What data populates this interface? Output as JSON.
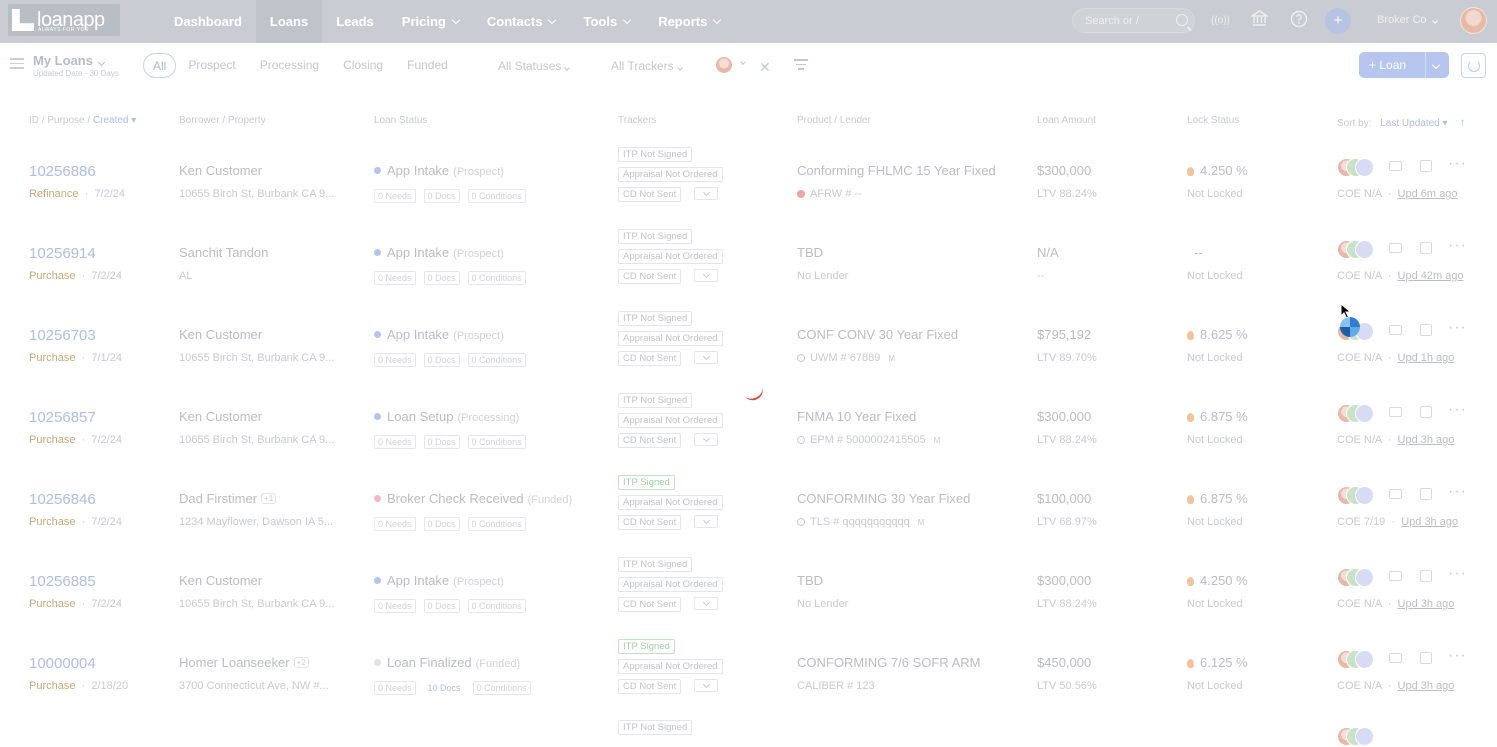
{
  "nav": {
    "logo_text": "loanapp",
    "logo_tag": "ALWAYS FOR YOU",
    "items": [
      {
        "label": "Dashboard",
        "active": false,
        "dropdown": false
      },
      {
        "label": "Loans",
        "active": true,
        "dropdown": false
      },
      {
        "label": "Leads",
        "active": false,
        "dropdown": false
      },
      {
        "label": "Pricing",
        "active": false,
        "dropdown": true
      },
      {
        "label": "Contacts",
        "active": false,
        "dropdown": true
      },
      {
        "label": "Tools",
        "active": false,
        "dropdown": true
      },
      {
        "label": "Reports",
        "active": false,
        "dropdown": true
      }
    ],
    "search_placeholder": "Search or /",
    "broadcast_icon": "((o))",
    "broker_label": "Broker Co"
  },
  "subbar": {
    "title": "My Loans",
    "subtitle": "Updated Date · 30 Days",
    "tabs": [
      "All",
      "Prospect",
      "Processing",
      "Closing",
      "Funded"
    ],
    "active_tab": "All",
    "status_filter": "All Statuses",
    "tracker_filter": "All Trackers",
    "new_loan_label": "+ Loan"
  },
  "columns": {
    "id_purpose": "ID / Purpose / ",
    "created": "Created",
    "borrower": "Borrower / Property",
    "status": "Loan Status",
    "trackers": "Trackers",
    "product": "Product / Lender",
    "amount": "Loan Amount",
    "lock": "Lock Status",
    "sort_by": "Sort by:",
    "sort_value": "Last Updated"
  },
  "loans": [
    {
      "id": "10256886",
      "purpose": "Refinance",
      "date": "7/2/24",
      "borrower": "Ken Customer",
      "co": "",
      "address": "10655 Birch St, Burbank CA 9...",
      "status": "App Intake",
      "stage": "(Prospect)",
      "dot": "blue",
      "needs": "0 Needs",
      "docs": "0 Docs",
      "conditions": "0 Conditions",
      "docs_blue": false,
      "t1": "ITP Not Signed",
      "t1_green": false,
      "t2": "Appraisal Not Ordered",
      "t3": "CD Not Sent",
      "product": "Conforming FHLMC 15 Year Fixed",
      "lender": "AFRW # --",
      "lender_icon": "red",
      "mtag": "",
      "amount": "$300,000",
      "ltv": "LTV 88.24%",
      "rate": "4.250 %",
      "rate_flame": true,
      "lock": "Not Locked",
      "coe": "COE N/A",
      "upd": "Upd 6m ago"
    },
    {
      "id": "10256914",
      "purpose": "Purchase",
      "date": "7/2/24",
      "borrower": "Sanchit Tandon",
      "co": "",
      "address": "AL",
      "status": "App Intake",
      "stage": "(Prospect)",
      "dot": "blue",
      "needs": "0 Needs",
      "docs": "0 Docs",
      "conditions": "0 Conditions",
      "docs_blue": false,
      "t1": "ITP Not Signed",
      "t1_green": false,
      "t2": "Appraisal Not Ordered",
      "t3": "CD Not Sent",
      "product": "TBD",
      "lender": "No Lender",
      "lender_icon": "",
      "mtag": "",
      "amount": "N/A",
      "ltv": "--",
      "rate": "--",
      "rate_flame": false,
      "lock": "Not Locked",
      "coe": "COE N/A",
      "upd": "Upd 42m ago"
    },
    {
      "id": "10256703",
      "purpose": "Purchase",
      "date": "7/1/24",
      "borrower": "Ken Customer",
      "co": "",
      "address": "10655 Birch St, Burbank CA 9...",
      "status": "App Intake",
      "stage": "(Prospect)",
      "dot": "blue",
      "needs": "0 Needs",
      "docs": "0 Docs",
      "conditions": "0 Conditions",
      "docs_blue": false,
      "t1": "ITP Not Signed",
      "t1_green": false,
      "t2": "Appraisal Not Ordered",
      "t3": "CD Not Sent",
      "product": "CONF CONV 30 Year Fixed",
      "lender": "UWM # 67889",
      "lender_icon": "gray",
      "mtag": "M",
      "amount": "$795,192",
      "ltv": "LTV 89.70%",
      "rate": "8.625 %",
      "rate_flame": true,
      "lock": "Not Locked",
      "coe": "COE N/A",
      "upd": "Upd 1h ago"
    },
    {
      "id": "10256857",
      "purpose": "Purchase",
      "date": "7/2/24",
      "borrower": "Ken Customer",
      "co": "",
      "address": "10655 Birch St, Burbank CA 9...",
      "status": "Loan Setup",
      "stage": "(Processing)",
      "dot": "blue",
      "needs": "0 Needs",
      "docs": "0 Docs",
      "conditions": "0 Conditions",
      "docs_blue": false,
      "t1": "ITP Not Signed",
      "t1_green": false,
      "t2": "Appraisal Not Ordered",
      "t3": "CD Not Sent",
      "product": "FNMA 10 Year Fixed",
      "lender": "EPM # 5000002415505",
      "lender_icon": "gray",
      "mtag": "M",
      "amount": "$300,000",
      "ltv": "LTV 88.24%",
      "rate": "6.875 %",
      "rate_flame": true,
      "lock": "Not Locked",
      "coe": "COE N/A",
      "upd": "Upd 3h ago"
    },
    {
      "id": "10256846",
      "purpose": "Purchase",
      "date": "7/2/24",
      "borrower": "Dad Firstimer",
      "co": "+1",
      "address": "1234 Mayflower, Dawson IA 5...",
      "status": "Broker Check Received",
      "stage": "(Funded)",
      "dot": "pink",
      "needs": "0 Needs",
      "docs": "0 Docs",
      "conditions": "0 Conditions",
      "docs_blue": false,
      "t1": "ITP Signed",
      "t1_green": true,
      "t2": "Appraisal Not Ordered",
      "t3": "CD Not Sent",
      "product": "CONFORMING 30 Year Fixed",
      "lender": "TLS # qqqqqqqqqqq",
      "lender_icon": "gray",
      "mtag": "M",
      "amount": "$100,000",
      "ltv": "LTV 68.97%",
      "rate": "6.875 %",
      "rate_flame": true,
      "lock": "Not Locked",
      "coe": "COE 7/19",
      "upd": "Upd 3h ago"
    },
    {
      "id": "10256885",
      "purpose": "Purchase",
      "date": "7/2/24",
      "borrower": "Ken Customer",
      "co": "",
      "address": "10655 Birch St, Burbank CA 9...",
      "status": "App Intake",
      "stage": "(Prospect)",
      "dot": "blue",
      "needs": "0 Needs",
      "docs": "0 Docs",
      "conditions": "0 Conditions",
      "docs_blue": false,
      "t1": "ITP Not Signed",
      "t1_green": false,
      "t2": "Appraisal Not Ordered",
      "t3": "CD Not Sent",
      "product": "TBD",
      "lender": "No Lender",
      "lender_icon": "",
      "mtag": "",
      "amount": "$300,000",
      "ltv": "LTV 88.24%",
      "rate": "4.250 %",
      "rate_flame": true,
      "lock": "Not Locked",
      "coe": "COE N/A",
      "upd": "Upd 3h ago"
    },
    {
      "id": "10000004",
      "purpose": "Purchase",
      "date": "2/18/20",
      "borrower": "Homer Loanseeker",
      "co": "+2",
      "address": "3700 Connecticut Ave, NW #...",
      "status": "Loan Finalized",
      "stage": "(Funded)",
      "dot": "gray",
      "needs": "0 Needs",
      "docs": "10 Docs",
      "conditions": "0 Conditions",
      "docs_blue": true,
      "t1": "ITP Signed",
      "t1_green": true,
      "t2": "Appraisal Not Ordered",
      "t3": "CD Not Sent",
      "product": "CONFORMING 7/6 SOFR ARM",
      "lender": "CALIBER # 123",
      "lender_icon": "",
      "mtag": "",
      "amount": "$450,000",
      "ltv": "LTV 50.56%",
      "rate": "6.125 %",
      "rate_flame": true,
      "lock": "Not Locked",
      "coe": "COE N/A",
      "upd": "Upd 3h ago"
    }
  ],
  "partial_row": {
    "t1": "ITP Not Signed"
  }
}
